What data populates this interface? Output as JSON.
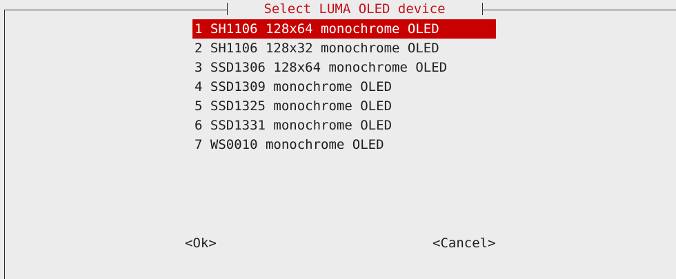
{
  "dialog": {
    "title": "Select LUMA OLED device",
    "items": [
      {
        "num": "1",
        "label": "SH1106 128x64 monochrome OLED",
        "selected": true
      },
      {
        "num": "2",
        "label": "SH1106 128x32 monochrome OLED",
        "selected": false
      },
      {
        "num": "3",
        "label": "SSD1306 128x64 monochrome OLED",
        "selected": false
      },
      {
        "num": "4",
        "label": "SSD1309 monochrome OLED",
        "selected": false
      },
      {
        "num": "5",
        "label": "SSD1325 monochrome OLED",
        "selected": false
      },
      {
        "num": "6",
        "label": "SSD1331 monochrome OLED",
        "selected": false
      },
      {
        "num": "7",
        "label": "WS0010 monochrome OLED",
        "selected": false
      }
    ],
    "ok_label": "<Ok>",
    "cancel_label": "<Cancel>"
  },
  "colors": {
    "background": "#ececec",
    "selection": "#c80000",
    "title": "#c3101b",
    "text": "#1e1e1e"
  }
}
